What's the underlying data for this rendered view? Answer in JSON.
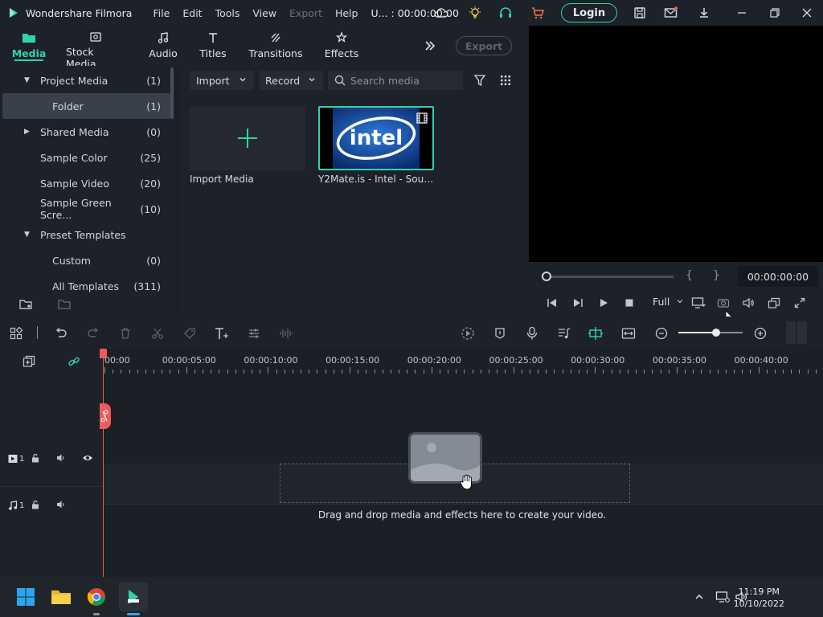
{
  "app": {
    "title": "Wondershare Filmora",
    "menu": [
      "File",
      "Edit",
      "Tools",
      "View",
      "Export",
      "Help"
    ],
    "project_time": "U... : 00:00:00:00",
    "login_label": "Login"
  },
  "tabs": [
    {
      "label": "Media",
      "icon": "media-icon",
      "active": true
    },
    {
      "label": "Stock Media",
      "icon": "stock-icon"
    },
    {
      "label": "Audio",
      "icon": "audio-icon"
    },
    {
      "label": "Titles",
      "icon": "titles-icon"
    },
    {
      "label": "Transitions",
      "icon": "transitions-icon"
    },
    {
      "label": "Effects",
      "icon": "effects-icon"
    }
  ],
  "export_label": "Export",
  "sidebar": {
    "items": [
      {
        "label": "Project Media",
        "count": "(1)",
        "expanded": true
      },
      {
        "label": "Folder",
        "count": "(1)",
        "selected": true
      },
      {
        "label": "Shared Media",
        "count": "(0)",
        "expanded": false
      },
      {
        "label": "Sample Color",
        "count": "(25)"
      },
      {
        "label": "Sample Video",
        "count": "(20)"
      },
      {
        "label": "Sample Green Scre...",
        "count": "(10)"
      },
      {
        "label": "Preset Templates",
        "count": "",
        "expanded": true
      },
      {
        "label": "Custom",
        "count": "(0)"
      },
      {
        "label": "All Templates",
        "count": "(311)"
      }
    ]
  },
  "media": {
    "import_label": "Import",
    "record_label": "Record",
    "search_placeholder": "Search media",
    "import_card_label": "Import Media",
    "video_card_label": "Y2Mate.is - Intel - Soun...",
    "video_logo_text": "intel"
  },
  "preview": {
    "timecode": "00:00:00:00",
    "quality": "Full",
    "brace_open": "{",
    "brace_close": "}"
  },
  "timeline": {
    "ruler_labels": [
      "00:00",
      "00:00:05:00",
      "00:00:10:00",
      "00:00:15:00",
      "00:00:20:00",
      "00:00:25:00",
      "00:00:30:00",
      "00:00:35:00",
      "00:00:40:00"
    ],
    "video_track_num": "1",
    "audio_track_num": "1",
    "drop_hint": "Drag and drop media and effects here to create your video."
  },
  "taskbar": {
    "time": "11:19 PM",
    "date": "10/10/2022"
  },
  "colors": {
    "accent": "#2fd3b0",
    "playhead": "#f05a5a",
    "panel": "#1d2129"
  }
}
